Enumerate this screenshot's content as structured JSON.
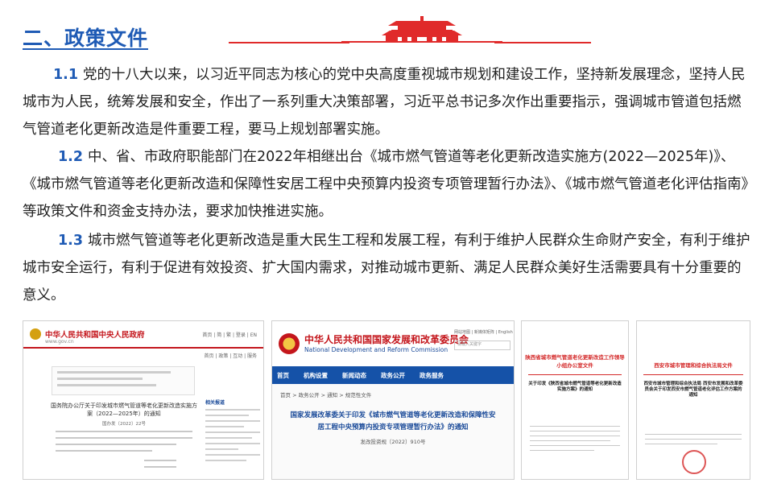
{
  "title": "二、政策文件",
  "accent_color": "#1f5bb5",
  "decor_color": "#e02a2a",
  "paragraphs": [
    {
      "num": "1.1",
      "text": "党的十八大以来，以习近平同志为核心的党中央高度重视城市规划和建设工作，坚持新发展理念，坚持人民城市为人民，统筹发展和安全，作出了一系列重大决策部署，习近平总书记多次作出重要指示，强调城市管道包括燃气管道老化更新改造是件重要工程，要马上规划部署实施。"
    },
    {
      "num": "1.2",
      "text": "中、省、市政府职能部门在2022年相继出台《城市燃气管道等老化更新改造实施方(2022—2025年)》、《城市燃气管道等老化更新改造和保障性安居工程中央预算内投资专项管理暂行办法》、《城市燃气管道老化评估指南》等政策文件和资金支持办法，要求加快推进实施。"
    },
    {
      "num": "1.3",
      "text": "城市燃气管道等老化更新改造是重大民生工程和发展工程，有利于维护人民群众生命财产安全，有利于维护城市安全运行，有利于促进有效投资、扩大国内需求，对推动城市更新、满足人民群众美好生活需要具有十分重要的意义。"
    }
  ],
  "documents": {
    "gov": {
      "site_name": "中华人民共和国中央人民政府",
      "site_url": "www.gov.cn",
      "nav": "首页 | 简 | 繁 | 登录 | EN",
      "tools": "首页 | 政策 | 互动 | 服务",
      "doc_title": "国务院办公厅关于印发城市燃气管道等老化更新改造实施方案（2022—2025年）的通知",
      "doc_number": "国办发〔2022〕22号",
      "sidebar_title": "相关报道"
    },
    "ndrc": {
      "name_cn": "中华人民共和国国家发展和改革委员会",
      "name_en": "National Development and Reform Commission",
      "top_links": "网站地图 | 新媒体矩阵 | English",
      "search_placeholder": "请输入关键字",
      "nav": [
        "首页",
        "机构设置",
        "新闻动态",
        "政务公开",
        "政务服务"
      ],
      "breadcrumb": "首页 > 政务公开 > 通知 > 规范性文件",
      "doc_title": "国家发展改革委关于印发《城市燃气管道等老化更新改造和保障性安居工程中央预算内投资专项管理暂行办法》的通知",
      "doc_number": "发改投资规〔2022〕910号"
    },
    "shaanxi": {
      "header": "陕西省城市燃气管道老化更新改造工作领导小组办公室文件",
      "doc_title": "关于印发《陕西省城市燃气管道等老化更新改造实施方案》的通知"
    },
    "xian": {
      "header": "西安市城市管理和综合执法局文件",
      "doc_title": "西安市城市管理和综合执法局 西安市发展和改革委员会关于印发西安市燃气管道老化评估工作方案的通知"
    }
  }
}
